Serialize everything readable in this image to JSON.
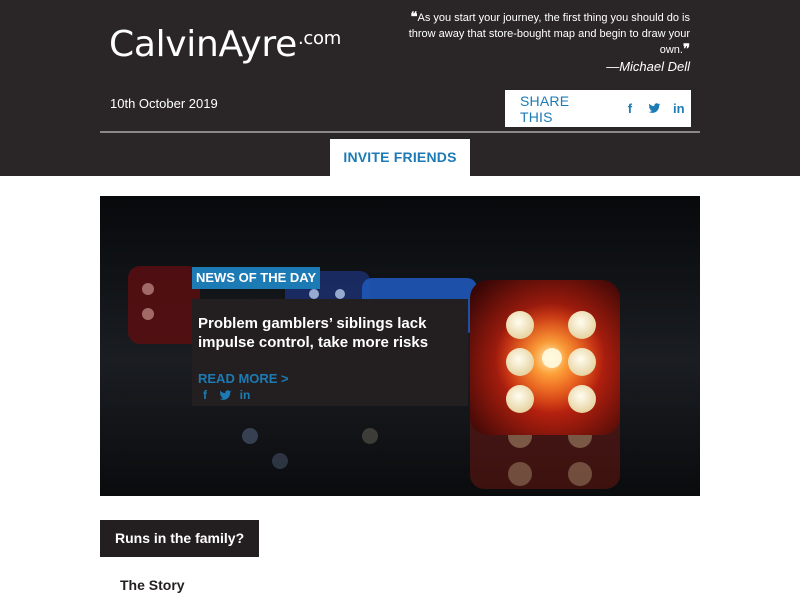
{
  "header": {
    "logo_main": "CalvinAyre",
    "logo_suffix": ".com",
    "quote_text": "As you start your journey, the first thing you should do is throw away that store-bought map and begin to draw your own.",
    "quote_author": "—Michael Dell",
    "date": "10th October 2019",
    "share": {
      "label": "SHARE THIS",
      "icons": [
        "facebook-icon",
        "twitter-icon",
        "linkedin-icon"
      ]
    },
    "invite_label": "INVITE FRIENDS"
  },
  "hero": {
    "tag": "NEWS OF THE DAY",
    "title": "Problem gamblers’ siblings lack impulse control, take more risks",
    "read_more": "READ MORE >",
    "social_icons": [
      "facebook-icon",
      "twitter-icon",
      "linkedin-icon"
    ]
  },
  "section": {
    "label": "Runs in the family?",
    "subheading": "The Story"
  },
  "colors": {
    "header_bg": "#2a2627",
    "accent_blue": "#1c7ab5",
    "dark_box": "#231f20"
  }
}
